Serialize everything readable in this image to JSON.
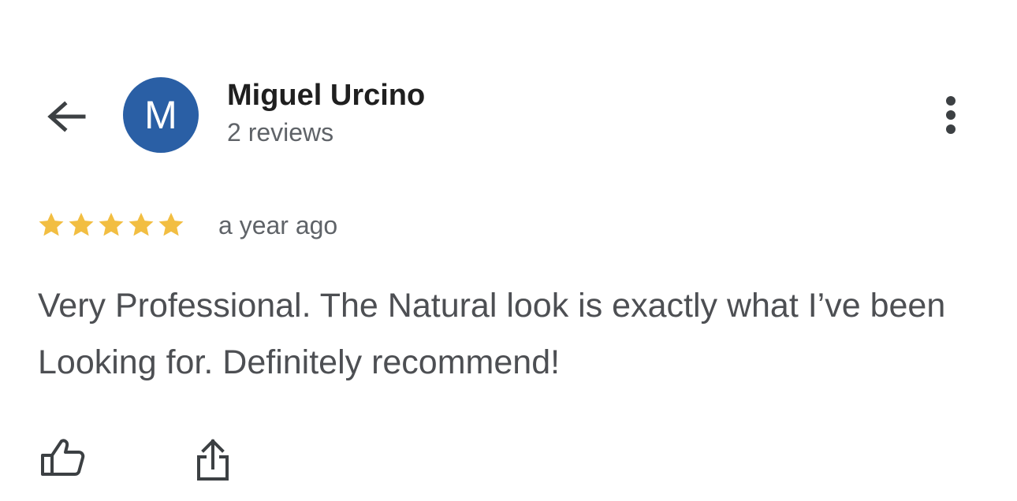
{
  "header": {
    "back_icon": "arrow-left-icon",
    "avatar_initial": "M",
    "avatar_color": "#2a5fa5",
    "reviewer_name": "Miguel Urcino",
    "review_count": "2 reviews",
    "more_icon": "more-vert-icon"
  },
  "review": {
    "rating": 5,
    "rating_max": 5,
    "star_color": "#f2be42",
    "time": "a year ago",
    "text": "Very Professional. The Natural look is exactly what I’ve been Looking for. Definitely recommend!"
  },
  "actions": {
    "like_icon": "thumbs-up-icon",
    "share_icon": "share-icon"
  }
}
